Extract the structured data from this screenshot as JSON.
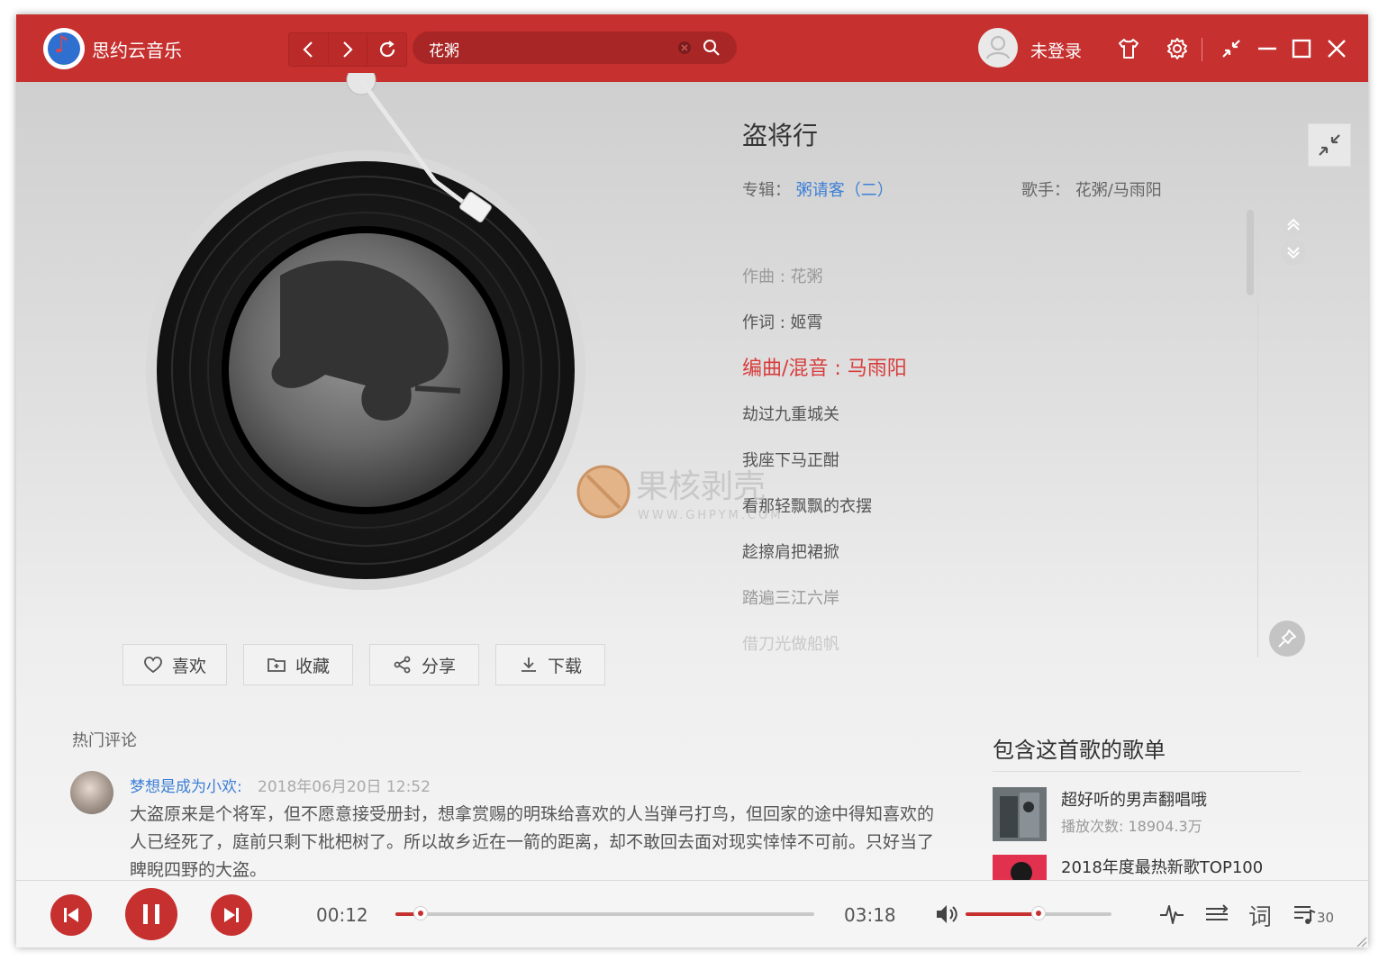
{
  "app": {
    "name": "思约云音乐"
  },
  "search": {
    "value": "花粥"
  },
  "user": {
    "login_label": "未登录"
  },
  "song": {
    "title": "盗将行",
    "album_label": "专辑：",
    "album": "粥请客（二）",
    "singer_label": "歌手：",
    "singer": "花粥/马雨阳"
  },
  "lyrics": [
    {
      "text": "作曲 : 花粥",
      "state": "dim"
    },
    {
      "text": "作词 : 姬霄",
      "state": "normal"
    },
    {
      "text": "编曲/混音 : 马雨阳",
      "state": "active"
    },
    {
      "text": "劫过九重城关",
      "state": "normal"
    },
    {
      "text": "我座下马正酣",
      "state": "normal"
    },
    {
      "text": "看那轻飘飘的衣摆",
      "state": "normal"
    },
    {
      "text": "趁擦肩把裙掀",
      "state": "normal"
    },
    {
      "text": "踏遍三江六岸",
      "state": "dim"
    },
    {
      "text": "借刀光做船帆",
      "state": "faint"
    }
  ],
  "actions": {
    "like": "喜欢",
    "collect": "收藏",
    "share": "分享",
    "download": "下载"
  },
  "comments": {
    "title": "热门评论",
    "items": [
      {
        "user": "梦想是成为小欢:",
        "time": "2018年06月20日 12:52",
        "text": "大盗原来是个将军，但不愿意接受册封，想拿赏赐的明珠给喜欢的人当弹弓打鸟，但回家的途中得知喜欢的人已经死了，庭前只剩下枇杷树了。所以故乡近在一箭的距离，却不敢回去面对现实悻悻不可前。只好当了睥睨四野的大盗。"
      }
    ]
  },
  "playlists": {
    "title": "包含这首歌的歌单",
    "items": [
      {
        "name": "超好听的男声翻唱哦",
        "count": "播放次数: 18904.3万"
      },
      {
        "name": "2018年度最热新歌TOP100",
        "count": ""
      }
    ]
  },
  "player": {
    "current_time": "00:12",
    "total_time": "03:18",
    "progress": 0.06,
    "volume": 0.5,
    "lyric_button": "词",
    "queue_count": "30"
  },
  "watermark": {
    "text": "果核剥壳",
    "sub": "WWW.GHPYM.COM"
  },
  "colors": {
    "accent": "#c6302f",
    "link": "#3d7fd6",
    "active_lyric": "#d83c3c"
  }
}
